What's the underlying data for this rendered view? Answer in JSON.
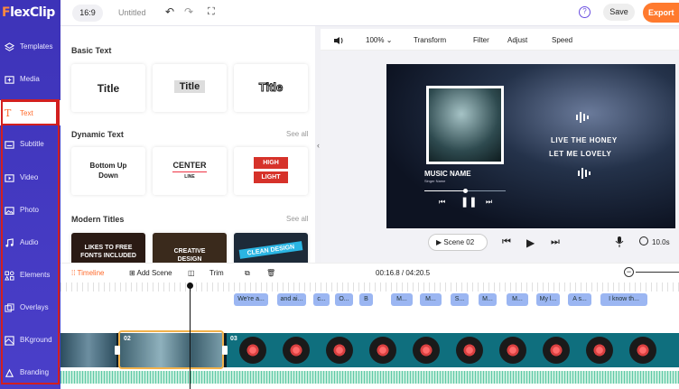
{
  "app": {
    "logo_f": "F",
    "logo_rest": "lexClip"
  },
  "sidebar": {
    "items": [
      {
        "label": "Templates",
        "icon": "layers-icon"
      },
      {
        "label": "Media",
        "icon": "media-icon"
      },
      {
        "label": "Text",
        "icon": "text-icon"
      },
      {
        "label": "Subtitle",
        "icon": "subtitle-icon"
      },
      {
        "label": "Video",
        "icon": "video-icon"
      },
      {
        "label": "Photo",
        "icon": "photo-icon"
      },
      {
        "label": "Audio",
        "icon": "music-icon"
      },
      {
        "label": "Elements",
        "icon": "elements-icon"
      },
      {
        "label": "Overlays",
        "icon": "overlays-icon"
      },
      {
        "label": "BKground",
        "icon": "background-icon"
      },
      {
        "label": "Branding",
        "icon": "branding-icon"
      }
    ],
    "active": "Text"
  },
  "topbar": {
    "ratio": "16:9",
    "title": "Untitled",
    "help": "?",
    "save": "Save",
    "export": "Export"
  },
  "panel": {
    "basic_text_heading": "Basic Text",
    "basic_cards": [
      "Title",
      "Title",
      "Title"
    ],
    "dynamic_text_heading": "Dynamic Text",
    "dynamic_see_all": "See all",
    "dynamic_cards": {
      "bottom_up": "Bottom Up Down",
      "center": "CENTER",
      "center_sub": "LINE",
      "high": "HIGH",
      "light": "LIGHT"
    },
    "modern_titles_heading": "Modern Titles",
    "modern_see_all": "See all",
    "modern_cards": [
      "LIKES TO FREE FONTS INCLUDED",
      "CREATIVE DESIGN",
      "CLEAN DESIGN"
    ]
  },
  "preview_toolbar": {
    "zoom": "100%",
    "transform": "Transform",
    "filter": "Filter",
    "adjust": "Adjust",
    "speed": "Speed"
  },
  "canvas": {
    "music_name": "MUSIC NAME",
    "singer": "Singer Name",
    "progress": 0.5,
    "lyric_line1": "LIVE THE HONEY",
    "lyric_line2": "LET ME LOVELY"
  },
  "playback": {
    "scene": "Scene 02",
    "duration": "10.0s"
  },
  "timeline": {
    "tab": "Timeline",
    "add_scene": "Add Scene",
    "trim": "Trim",
    "time": "00:16.8 / 04:20.5",
    "text_chips": [
      "We're a...",
      "and ai...",
      "c...",
      "O...",
      "B",
      "M...",
      "M...",
      "S...",
      "M...",
      "M...",
      "My l...",
      "A s...",
      "I know th..."
    ],
    "clip_labels": [
      "02",
      "03"
    ]
  },
  "colors": {
    "sidebar": "#4a3fc9",
    "accent": "#ff7a2e",
    "active_text": "#ff6a2b",
    "highlight": "#d21f1f"
  }
}
